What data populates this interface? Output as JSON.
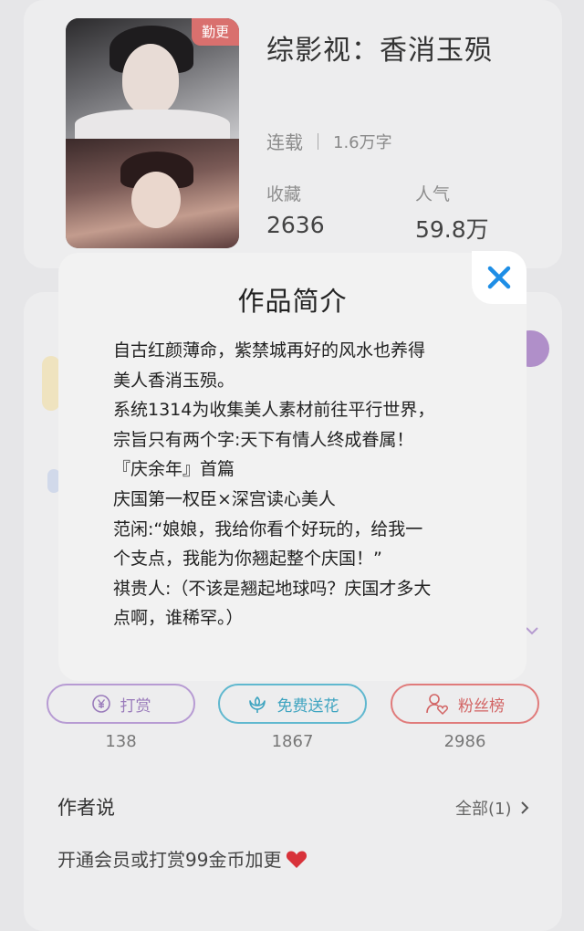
{
  "book": {
    "badge": "勤更",
    "title": "综影视：香消玉殒",
    "status": "连载",
    "word_count": "1.6万字",
    "stats": [
      {
        "label": "收藏",
        "value": "2636"
      },
      {
        "label": "人气",
        "value": "59.8万"
      }
    ]
  },
  "dialog": {
    "title": "作品简介",
    "lines": [
      "自古红颜薄命，紫禁城再好的风水也养得",
      "美人香消玉殒。",
      "系统1314为收集美人素材前往平行世界，",
      "宗旨只有两个字:天下有情人终成眷属！",
      "『庆余年』首篇",
      "庆国第一权臣×深宫读心美人",
      "范闲:“娘娘，我给你看个好玩的，给我一",
      "个支点，我能为你翘起整个庆国！”",
      "祺贵人:（不该是翘起地球吗？庆国才多大",
      "点啊，谁稀罕。）"
    ]
  },
  "actions": [
    {
      "label": "打赏",
      "count": "138",
      "icon": "yen-coin-icon"
    },
    {
      "label": "免费送花",
      "count": "1867",
      "icon": "flower-icon"
    },
    {
      "label": "粉丝榜",
      "count": "2986",
      "icon": "user-heart-icon"
    }
  ],
  "author_section": {
    "title": "作者说",
    "view_all": "全部(1)",
    "message": "开通会员或打赏99金币加更"
  },
  "colors": {
    "dialog_bg": "#f2f2f2",
    "close_icon": "#1e8ee6",
    "badge": "#d9706e",
    "reward": "#9a7bbb",
    "flower": "#3ea4c0",
    "fans": "#d26464",
    "heart": "#d8323a"
  }
}
